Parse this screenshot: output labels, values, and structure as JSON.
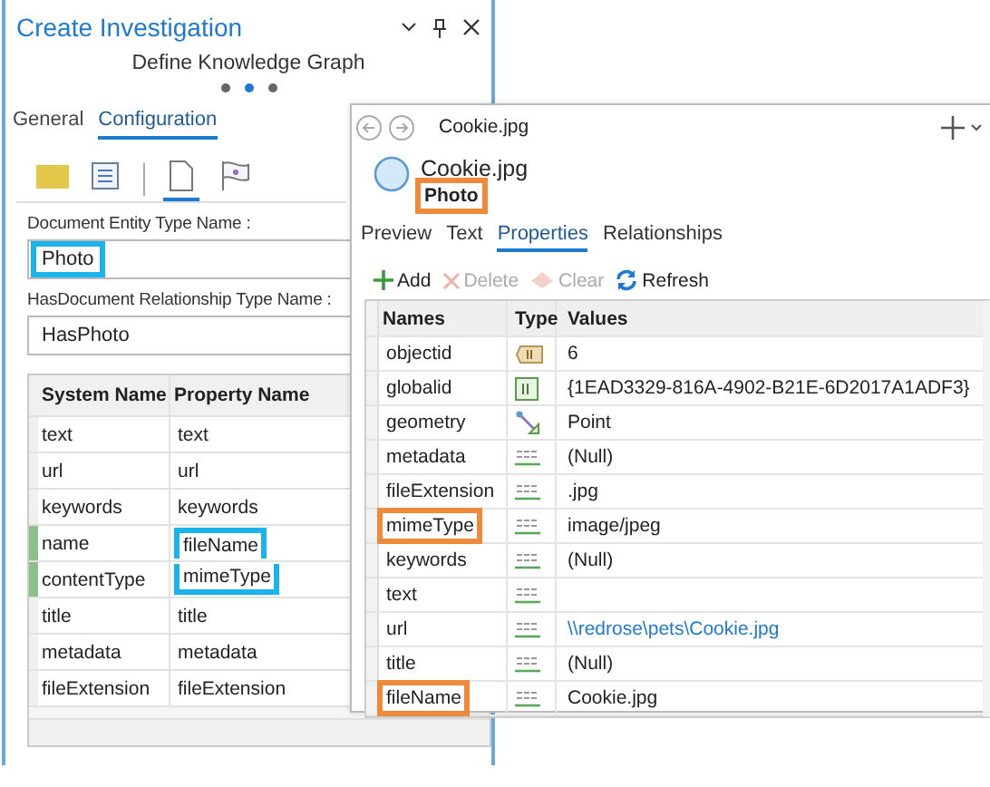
{
  "pane": {
    "title": "Create Investigation",
    "subtitle": "Define Knowledge Graph",
    "steps": [
      {
        "selected": false
      },
      {
        "selected": true
      },
      {
        "selected": false
      }
    ],
    "tabs": [
      {
        "label": "General",
        "selected": false
      },
      {
        "label": "Configuration",
        "selected": true
      }
    ],
    "tool_icons": [
      {
        "kind": "folder",
        "selected": false
      },
      {
        "kind": "list",
        "selected": false
      },
      {
        "kind": "document",
        "selected": true
      },
      {
        "kind": "flag",
        "selected": false
      }
    ],
    "entity_label": "Document Entity Type Name :",
    "entity_value": "Photo",
    "entity_highlighted": true,
    "relationship_label": "HasDocument Relationship Type Name :",
    "relationship_value": "HasPhoto",
    "table": {
      "columns": [
        "System Name",
        "Property Name"
      ],
      "rows": [
        {
          "system": "text",
          "property": "text",
          "modified": false,
          "highlighted": false
        },
        {
          "system": "url",
          "property": "url",
          "modified": false,
          "highlighted": false
        },
        {
          "system": "keywords",
          "property": "keywords",
          "modified": false,
          "highlighted": false
        },
        {
          "system": "name",
          "property": "fileName",
          "modified": true,
          "highlighted": true
        },
        {
          "system": "contentType",
          "property": "mimeType",
          "modified": true,
          "highlighted": true
        },
        {
          "system": "title",
          "property": "title",
          "modified": false,
          "highlighted": false
        },
        {
          "system": "metadata",
          "property": "metadata",
          "modified": false,
          "highlighted": false
        },
        {
          "system": "fileExtension",
          "property": "fileExtension",
          "modified": false,
          "highlighted": false
        }
      ]
    }
  },
  "popup": {
    "title": "Cookie.jpg",
    "name": "Cookie.jpg",
    "type": "Photo",
    "type_highlighted": true,
    "tabs": [
      {
        "label": "Preview",
        "selected": false
      },
      {
        "label": "Text",
        "selected": false
      },
      {
        "label": "Properties",
        "selected": true
      },
      {
        "label": "Relationships",
        "selected": false
      }
    ],
    "toolbar": [
      {
        "kind": "add",
        "label": "Add",
        "disabled": false
      },
      {
        "kind": "delete",
        "label": "Delete",
        "disabled": true
      },
      {
        "kind": "clear",
        "label": "Clear",
        "disabled": true
      },
      {
        "kind": "refresh",
        "label": "Refresh",
        "disabled": false
      }
    ],
    "columns": [
      "Names",
      "Type",
      "Values"
    ],
    "rows": [
      {
        "name": "objectid",
        "kind": "oid",
        "value": "6",
        "highlighted": false
      },
      {
        "name": "globalid",
        "kind": "guid",
        "value": "{1EAD3329-816A-4902-B21E-6D2017A1ADF3}",
        "highlighted": false
      },
      {
        "name": "geometry",
        "kind": "geometry",
        "value": "Point",
        "highlighted": false
      },
      {
        "name": "metadata",
        "kind": "string",
        "value": "(Null)",
        "highlighted": false
      },
      {
        "name": "fileExtension",
        "kind": "string",
        "value": ".jpg",
        "highlighted": false
      },
      {
        "name": "mimeType",
        "kind": "string",
        "value": "image/jpeg",
        "highlighted": true
      },
      {
        "name": "keywords",
        "kind": "string",
        "value": "(Null)",
        "highlighted": false
      },
      {
        "name": "text",
        "kind": "string",
        "highlighted": false
      },
      {
        "name": "url",
        "kind": "string",
        "value": "\\\\redrose\\pets\\Cookie.jpg",
        "link": true,
        "highlighted": false
      },
      {
        "name": "title",
        "kind": "string",
        "value": "(Null)",
        "highlighted": false
      },
      {
        "name": "fileName",
        "kind": "string",
        "value": "Cookie.jpg",
        "highlighted": true
      }
    ]
  }
}
